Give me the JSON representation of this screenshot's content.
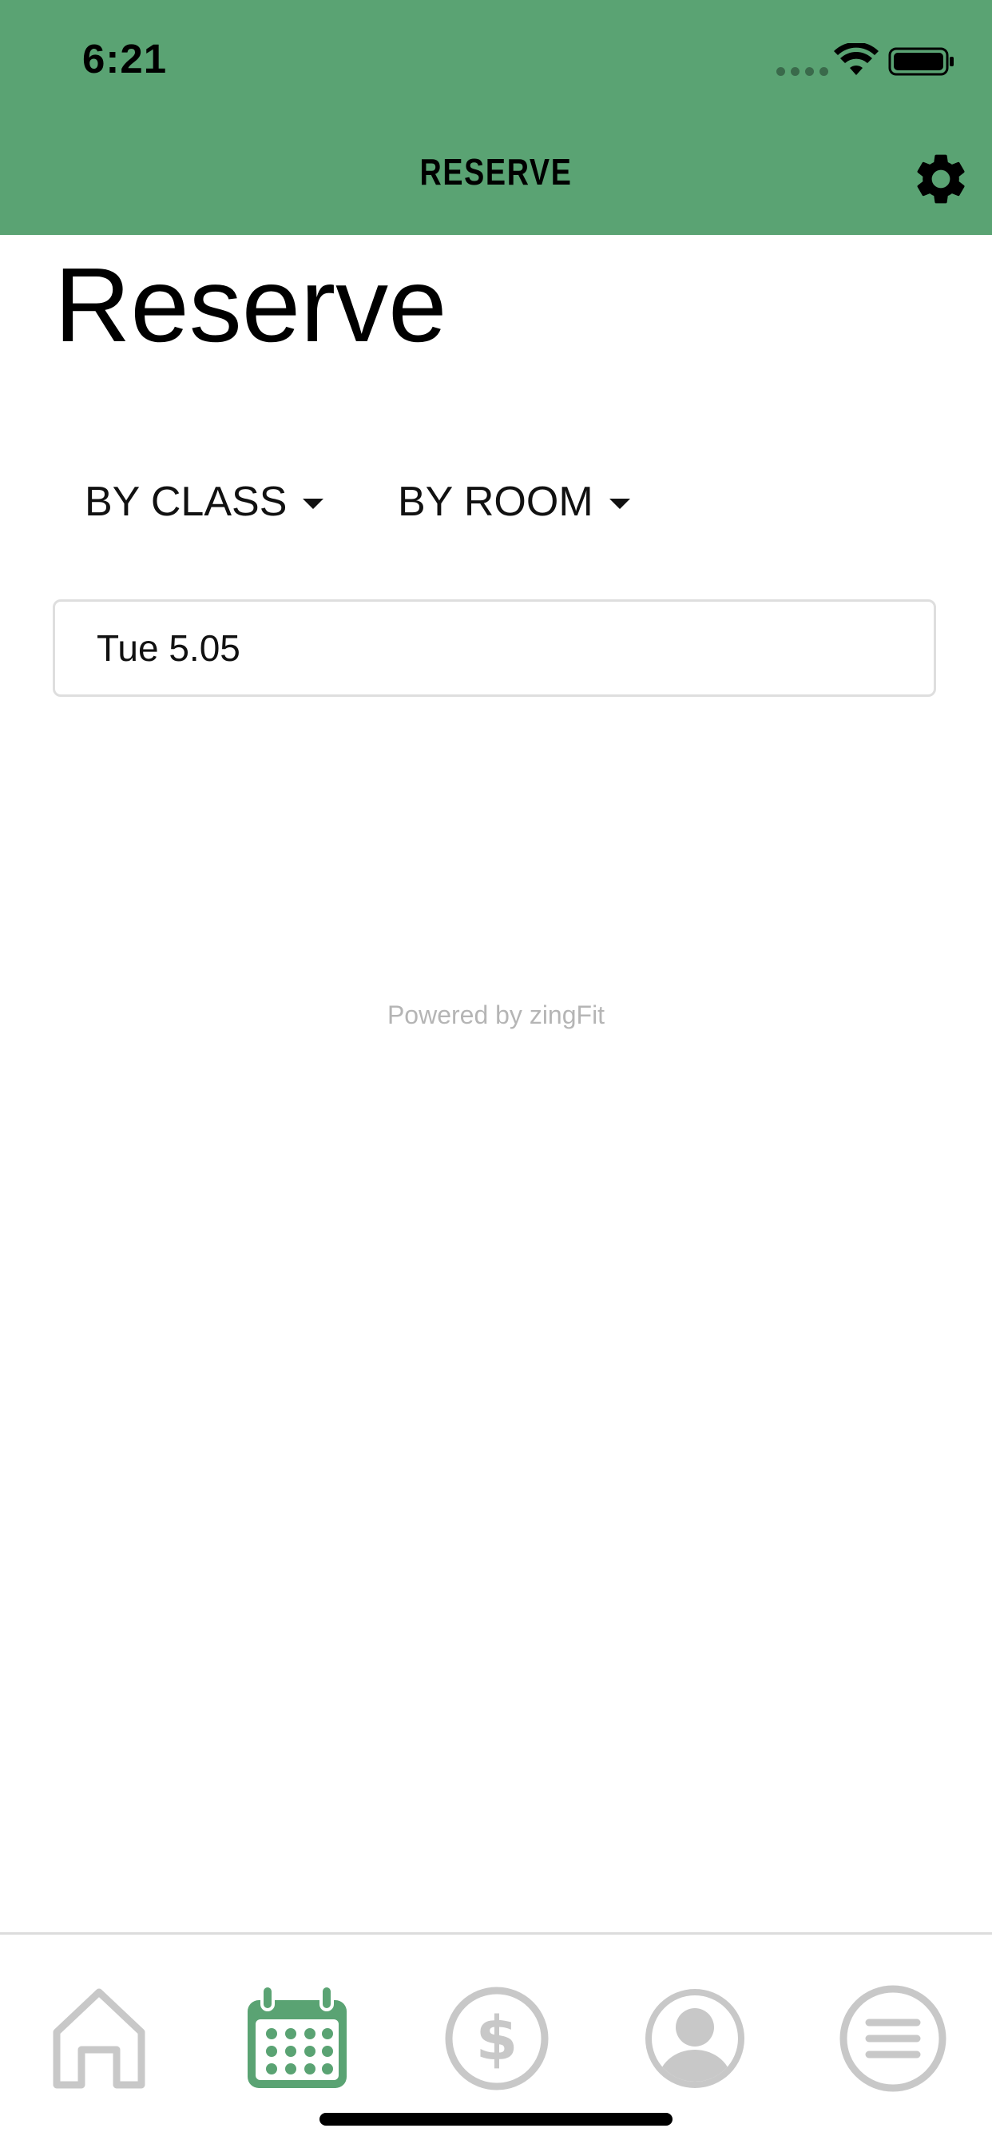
{
  "status_bar": {
    "time": "6:21"
  },
  "nav": {
    "title": "RESERVE",
    "settings_icon": "gear-icon"
  },
  "page": {
    "title": "Reserve",
    "filters": [
      {
        "label": "BY CLASS"
      },
      {
        "label": "BY ROOM"
      }
    ],
    "date_value": "Tue 5.05",
    "footer": "Powered by zingFit"
  },
  "tabbar": {
    "items": [
      {
        "icon": "home-icon",
        "active": false
      },
      {
        "icon": "calendar-icon",
        "active": true
      },
      {
        "icon": "dollar-icon",
        "active": false
      },
      {
        "icon": "user-icon",
        "active": false
      },
      {
        "icon": "menu-icon",
        "active": false
      }
    ]
  },
  "colors": {
    "accent": "#5aa373",
    "inactive_icon": "#c8c8c8",
    "footer_text": "#b5b5b5"
  }
}
